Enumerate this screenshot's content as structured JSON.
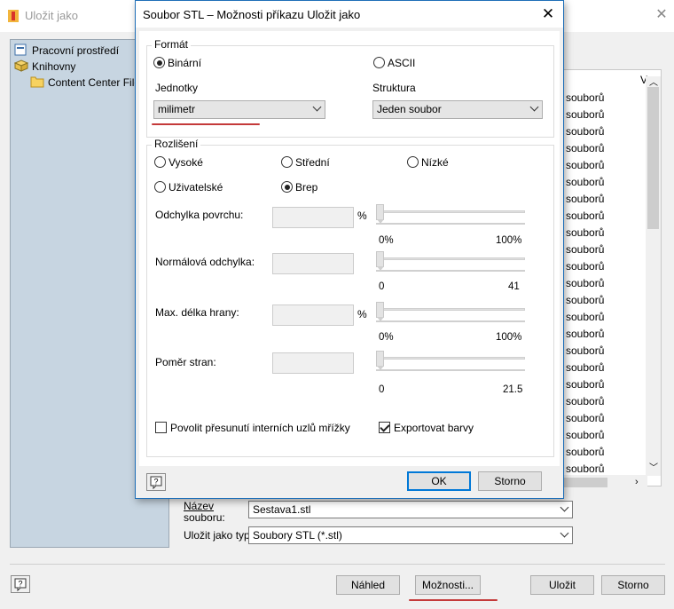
{
  "background_window": {
    "title": "Uložit jako",
    "tree": [
      {
        "label": "Pracovní prostředí",
        "icon": "workspace-icon"
      },
      {
        "label": "Knihovny",
        "icon": "libraries-icon"
      },
      {
        "label": "Content Center Files",
        "icon": "folder-icon"
      }
    ],
    "list_header": "V",
    "file_rows": [
      "souborů",
      "souborů",
      "souborů",
      "souborů",
      "souborů",
      "souborů",
      "souborů",
      "souborů",
      "souborů",
      "souborů",
      "souborů",
      "souborů",
      "souborů",
      "souborů",
      "souborů",
      "souborů",
      "souborů",
      "souborů",
      "souborů",
      "souborů",
      "souborů",
      "souborů",
      "souborů"
    ],
    "filename_label_line1": "Název",
    "filename_label_line2": "souboru:",
    "filename_value": "Sestava1.stl",
    "save_type_label": "Uložit jako typ:",
    "save_type_value": "Soubory STL (*.stl)",
    "buttons": {
      "preview": "Náhled",
      "options": "Možnosti...",
      "save": "Uložit",
      "cancel": "Storno"
    }
  },
  "dialog": {
    "title": "Soubor STL – Možnosti příkazu Uložit jako",
    "format": {
      "group_label": "Formát",
      "binary_label": "Binární",
      "binary_selected": true,
      "ascii_label": "ASCII",
      "ascii_selected": false,
      "units_label": "Jednotky",
      "units_value": "milimetr",
      "structure_label": "Struktura",
      "structure_value": "Jeden soubor"
    },
    "resolution": {
      "group_label": "Rozlišení",
      "options": [
        {
          "label": "Vysoké",
          "selected": false
        },
        {
          "label": "Střední",
          "selected": false
        },
        {
          "label": "Nízké",
          "selected": false
        },
        {
          "label": "Uživatelské",
          "selected": false
        },
        {
          "label": "Brep",
          "selected": true
        }
      ],
      "surface_deviation": {
        "label": "Odchylka povrchu:",
        "unit": "%",
        "min": "0%",
        "max": "100%"
      },
      "normal_deviation": {
        "label": "Normálová odchylka:",
        "min": "0",
        "max": "41"
      },
      "max_edge_length": {
        "label": "Max. délka hrany:",
        "unit": "%",
        "min": "0%",
        "max": "100%"
      },
      "aspect_ratio": {
        "label": "Poměr stran:",
        "min": "0",
        "max": "21.5"
      }
    },
    "allow_moving_nodes": {
      "label": "Povolit přesunutí interních uzlů mřížky",
      "checked": false
    },
    "export_colors": {
      "label": "Exportovat barvy",
      "checked": true
    },
    "ok_label": "OK",
    "cancel_label": "Storno"
  },
  "colors": {
    "annotation_underline": "#c43a3a",
    "dialog_border": "#1f6fb8"
  }
}
